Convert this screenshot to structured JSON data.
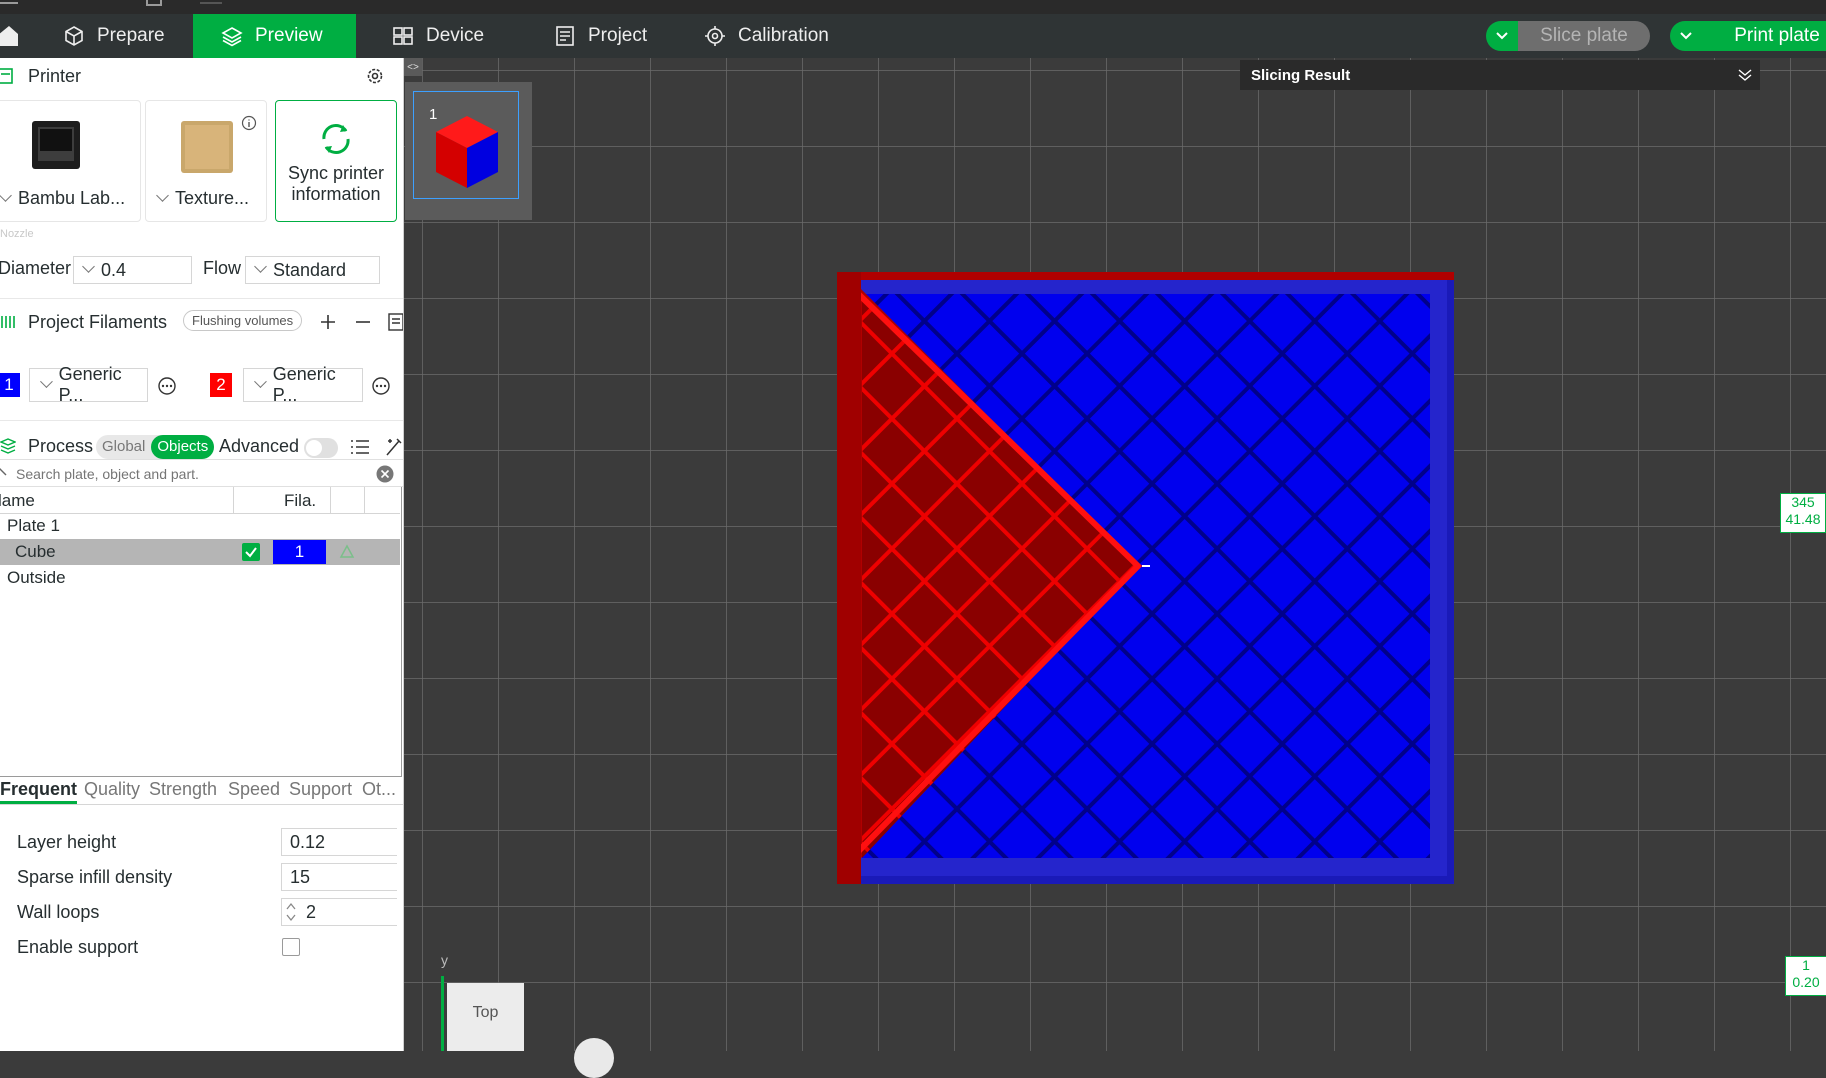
{
  "nav": {
    "prepare": "Prepare",
    "preview": "Preview",
    "device": "Device",
    "project": "Project",
    "calibration": "Calibration",
    "slice_plate": "Slice plate",
    "print_plate": "Print plate"
  },
  "printer": {
    "title": "Printer",
    "printer_name": "Bambu Lab...",
    "plate_type": "Texture...",
    "sync_line1": "Sync printer",
    "sync_line2": "information",
    "nozzle_label": "Nozzle",
    "diameter_label": "Diameter",
    "diameter_value": "0.4",
    "flow_label": "Flow",
    "flow_value": "Standard"
  },
  "filaments": {
    "title": "Project Filaments",
    "flushing": "Flushing volumes",
    "items": [
      {
        "index": "1",
        "name": "Generic P...",
        "color": "#0000ff"
      },
      {
        "index": "2",
        "name": "Generic P...",
        "color": "#ff0000"
      }
    ]
  },
  "process": {
    "title": "Process",
    "global": "Global",
    "objects": "Objects",
    "advanced": "Advanced",
    "search_placeholder": "Search plate, object and part."
  },
  "tree": {
    "col_name": "lame",
    "col_fila": "Fila.",
    "plate": "Plate 1",
    "object": "Cube",
    "object_filament": "1",
    "outside": "Outside"
  },
  "tabs": [
    "Frequent",
    "Quality",
    "Strength",
    "Speed",
    "Support",
    "Ot..."
  ],
  "params": [
    {
      "name": "Layer height",
      "value": "0.12"
    },
    {
      "name": "Sparse infill density",
      "value": "15"
    },
    {
      "name": "Wall loops",
      "value": "2"
    },
    {
      "name": "Enable support",
      "value": ""
    }
  ],
  "viewport": {
    "plate_number": "1",
    "slicing_result": "Slicing Result",
    "ruler_top_1": "345",
    "ruler_top_2": "41.48",
    "ruler_bottom_1": "1",
    "ruler_bottom_2": "0.20",
    "view_label": "Top",
    "axis_label": "y"
  },
  "colors": {
    "accent": "#00ae42",
    "filament_blue": "#0000ff",
    "filament_red": "#ff0000",
    "viewport_bg": "#3b3b3b"
  }
}
